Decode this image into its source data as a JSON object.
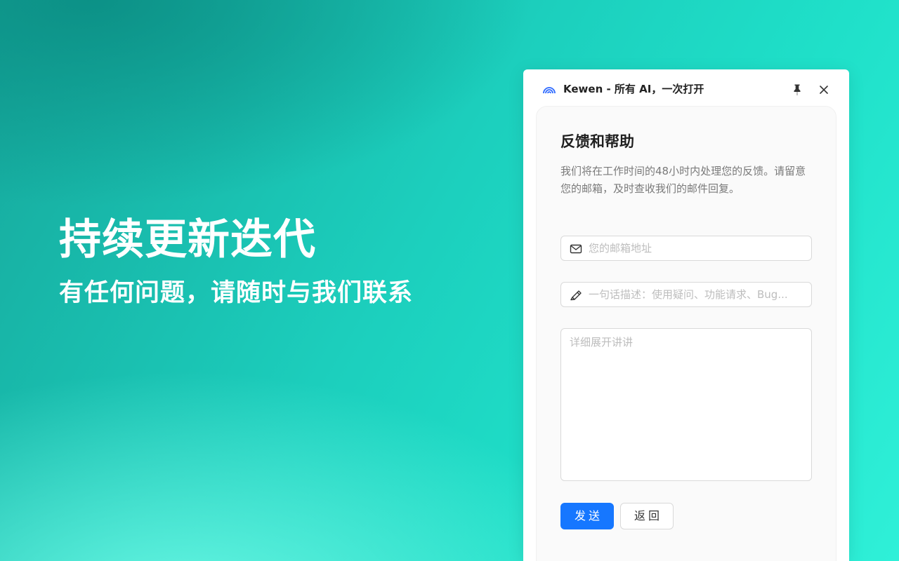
{
  "hero": {
    "title": "持续更新迭代",
    "subtitle": "有任何问题，请随时与我们联系"
  },
  "window": {
    "title": "Kewen - 所有 AI，一次打开",
    "logo_icon": "rainbow-arc-icon",
    "logo_color": "#2f6bff",
    "pin_icon": "pin-icon",
    "close_icon": "close-icon"
  },
  "feedback": {
    "heading": "反馈和帮助",
    "description": "我们将在工作时间的48小时内处理您的反馈。请留意您的邮箱，及时查收我们的邮件回复。",
    "email": {
      "icon": "mail-icon",
      "value": "",
      "placeholder": "您的邮箱地址"
    },
    "summary": {
      "icon": "highlighter-icon",
      "value": "",
      "placeholder": "一句话描述：使用疑问、功能请求、Bug..."
    },
    "details": {
      "value": "",
      "placeholder": "详细展开讲讲"
    },
    "send_label": "发送",
    "back_label": "返回"
  },
  "colors": {
    "primary": "#1677ff",
    "background_start": "#16a89c",
    "background_end": "#2ff0d8"
  }
}
